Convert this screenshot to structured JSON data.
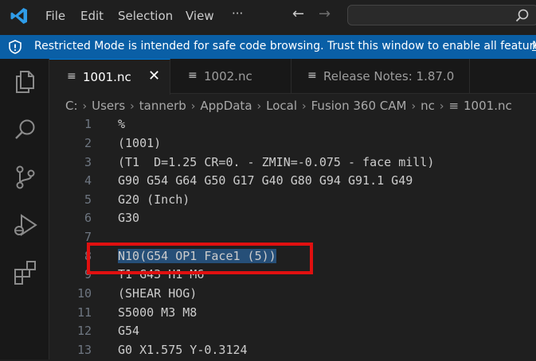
{
  "menu": {
    "file": "File",
    "edit": "Edit",
    "selection": "Selection",
    "view": "View",
    "more": "···"
  },
  "nav": {
    "back": "←",
    "forward": "→"
  },
  "banner": {
    "text": "Restricted Mode is intended for safe code browsing. Trust this window to enable all features.",
    "link": "M"
  },
  "tabs": [
    {
      "label": "1001.nc",
      "active": true,
      "icon": "lines-file-icon"
    },
    {
      "label": "1002.nc",
      "active": false,
      "icon": "lines-file-icon"
    },
    {
      "label": "Release Notes: 1.87.0",
      "active": false,
      "icon": "lines-file-icon"
    }
  ],
  "tab_close": "✕",
  "breadcrumb": [
    "C:",
    "Users",
    "tannerb",
    "AppData",
    "Local",
    "Fusion 360 CAM",
    "nc",
    "1001.nc"
  ],
  "lines": [
    {
      "num": "1",
      "text": "%"
    },
    {
      "num": "2",
      "text": "(1001)"
    },
    {
      "num": "3",
      "text": "(T1  D=1.25 CR=0. - ZMIN=-0.075 - face mill)"
    },
    {
      "num": "4",
      "text": "G90 G54 G64 G50 G17 G40 G80 G94 G91.1 G49"
    },
    {
      "num": "5",
      "text": "G20 (Inch)"
    },
    {
      "num": "6",
      "text": "G30"
    },
    {
      "num": "7",
      "text": ""
    },
    {
      "num": "8",
      "text": "N10(G54 OP1 Face1 (5))"
    },
    {
      "num": "9",
      "text": "T1 G43 H1 M6"
    },
    {
      "num": "10",
      "text": "(SHEAR HOG)"
    },
    {
      "num": "11",
      "text": "S5000 M3 M8"
    },
    {
      "num": "12",
      "text": "G54"
    },
    {
      "num": "13",
      "text": "G0 X1.575 Y-0.3124"
    }
  ],
  "colors": {
    "accent": "#0078d4",
    "banner": "#0a5fa6",
    "selection": "#264f78",
    "annotation": "#e01010"
  }
}
